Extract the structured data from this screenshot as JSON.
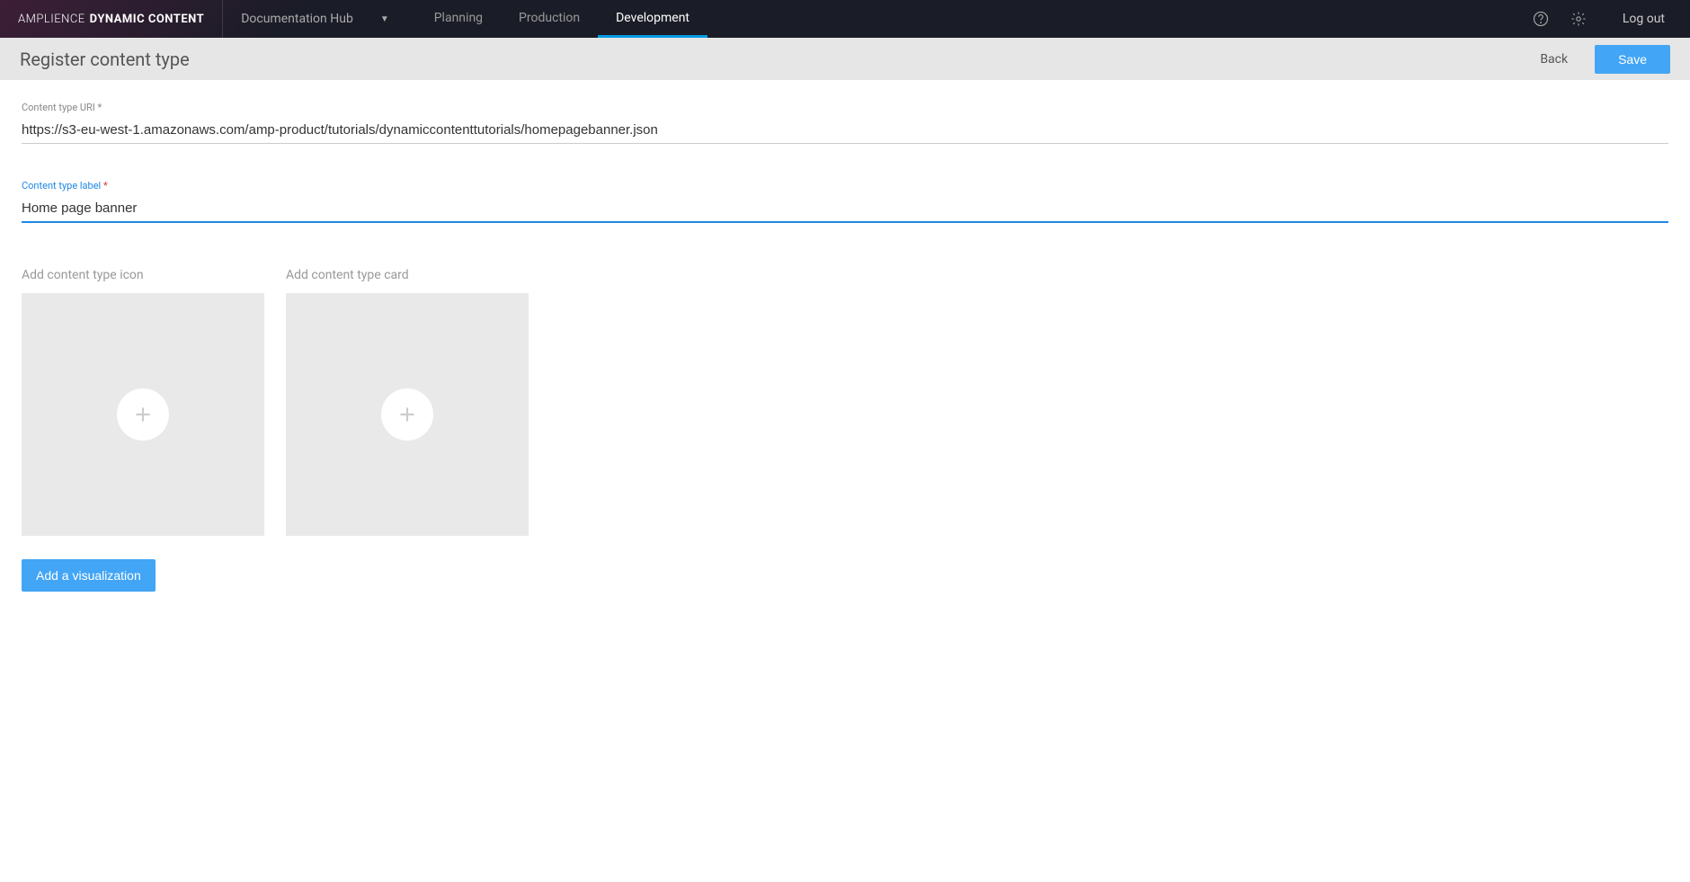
{
  "brand": {
    "thin": "AMPLIENCE",
    "bold": "DYNAMIC CONTENT"
  },
  "hub_dropdown": {
    "label": "Documentation Hub"
  },
  "nav": {
    "tabs": [
      {
        "label": "Planning",
        "active": false
      },
      {
        "label": "Production",
        "active": false
      },
      {
        "label": "Development",
        "active": true
      }
    ]
  },
  "top_right": {
    "logout": "Log out"
  },
  "subheader": {
    "title": "Register content type",
    "back": "Back",
    "save": "Save"
  },
  "fields": {
    "uri": {
      "label": "Content type URI",
      "required": "*",
      "value": "https://s3-eu-west-1.amazonaws.com/amp-product/tutorials/dynamiccontenttutorials/homepagebanner.json"
    },
    "label_field": {
      "label": "Content type label",
      "required": "*",
      "value": "Home page banner"
    }
  },
  "uploads": {
    "icon_label": "Add content type icon",
    "card_label": "Add content type card"
  },
  "buttons": {
    "add_viz": "Add a visualization"
  }
}
